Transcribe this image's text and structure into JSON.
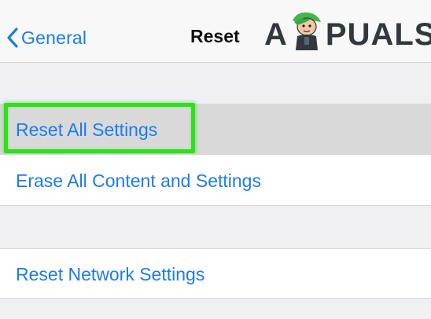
{
  "navbar": {
    "back_label": "General",
    "back_icon": "chevron-left-icon",
    "title": "Reset"
  },
  "watermark": {
    "letter_a": "A",
    "letters_rest": "PUALS",
    "mascot_icon": "appuals-mascot-icon"
  },
  "sections": [
    {
      "items": [
        {
          "label": "Reset All Settings",
          "highlighted": true
        },
        {
          "label": "Erase All Content and Settings"
        }
      ]
    },
    {
      "items": [
        {
          "label": "Reset Network Settings"
        }
      ]
    }
  ],
  "colors": {
    "accent": "#1b7cf0",
    "highlight_box": "#2fe01c",
    "background": "#efeff4",
    "selected_row": "#d9d9d9"
  }
}
